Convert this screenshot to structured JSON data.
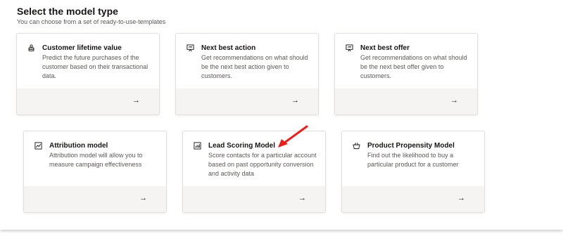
{
  "header": {
    "title": "Select the model type",
    "subtitle": "You can choose from a set of ready-to-use-templates"
  },
  "cards": [
    {
      "title": "Customer lifetime value",
      "description": "Predict the future purchases of the customer based on their transactional data.",
      "icon": "coins-icon",
      "action": "→"
    },
    {
      "title": "Next best action",
      "description": "Get recommendations on what should be the next best action given to customers.",
      "icon": "presentation-icon",
      "action": "→"
    },
    {
      "title": "Next best offer",
      "description": "Get recommendations on what should be the next best offer given to customers.",
      "icon": "presentation-icon",
      "action": "→"
    },
    {
      "title": "Attribution model",
      "description": "Attribution model will allow you to measure campaign effectiveness",
      "icon": "line-chart-icon",
      "action": "→"
    },
    {
      "title": "Lead Scoring Model",
      "description": "Score contacts for a particular account based on past opportunity conversion and activity data",
      "icon": "bar-chart-icon",
      "action": "→"
    },
    {
      "title": "Product Propensity Model",
      "description": "Find out the likelihood to buy a particular product for a customer",
      "icon": "basket-icon",
      "action": "→"
    }
  ],
  "colors": {
    "annotation_arrow": "#e8201b",
    "card_footer": "#f5f4f2",
    "title_text": "#161513",
    "body_text": "#5b5a57"
  }
}
